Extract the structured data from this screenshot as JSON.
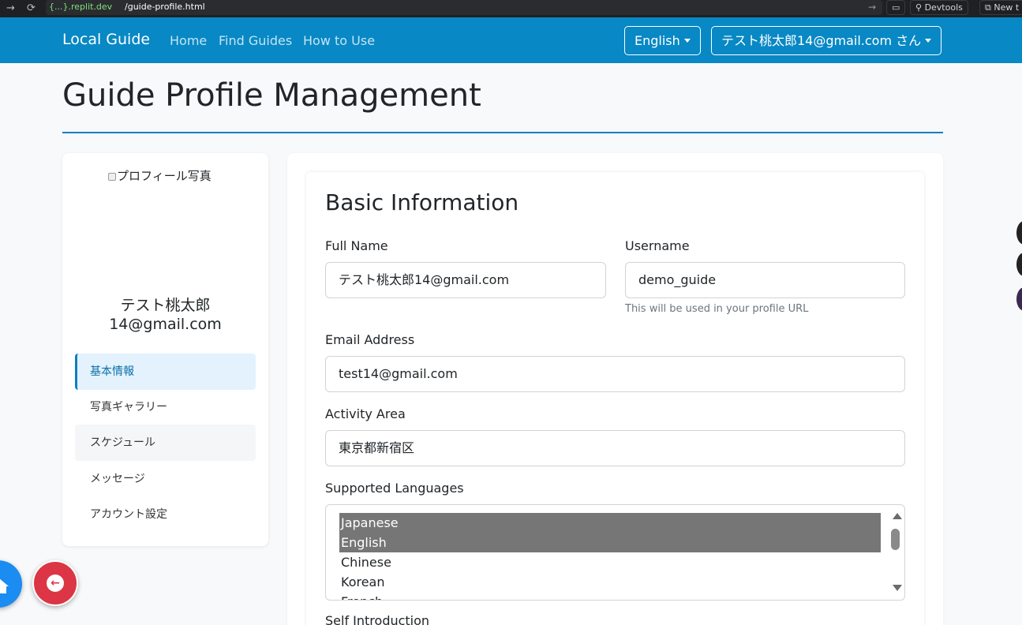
{
  "browser": {
    "url_domain": "{...}.replit.dev",
    "url_path": "/guide-profile.html",
    "devtools_label": "Devtools",
    "new_tab_label": "New t"
  },
  "navbar": {
    "brand": "Local Guide",
    "links": [
      "Home",
      "Find Guides",
      "How to Use"
    ],
    "language": "English",
    "user": "テスト桃太郎14@gmail.com さん"
  },
  "page": {
    "title": "Guide Profile Management"
  },
  "sidebar": {
    "photo_alt": "プロフィール写真",
    "name_line1": "テスト桃太郎",
    "name_line2": "14@gmail.com",
    "items": [
      "基本情報",
      "写真ギャラリー",
      "スケジュール",
      "メッセージ",
      "アカウント設定"
    ],
    "active_index": 0
  },
  "form": {
    "section_title": "Basic Information",
    "full_name": {
      "label": "Full Name",
      "value": "テスト桃太郎14@gmail.com"
    },
    "username": {
      "label": "Username",
      "value": "demo_guide",
      "help": "This will be used in your profile URL"
    },
    "email": {
      "label": "Email Address",
      "value": "test14@gmail.com"
    },
    "area": {
      "label": "Activity Area",
      "value": "東京都新宿区"
    },
    "languages": {
      "label": "Supported Languages",
      "options": [
        "Japanese",
        "English",
        "Chinese",
        "Korean",
        "French"
      ],
      "selected": [
        "Japanese",
        "English"
      ]
    },
    "intro_label": "Self Introduction"
  },
  "colors": {
    "navbar": "#0888c4",
    "accent": "#0b7fc1",
    "active_menu_bg": "#e3f2fd",
    "home_fab": "#1a8cf2",
    "back_fab": "#dc3545"
  },
  "icons": {
    "browser_back": "arrow-right-icon",
    "reload": "reload-icon",
    "home_fab": "home-icon",
    "back_fab": "arrow-left-icon"
  }
}
